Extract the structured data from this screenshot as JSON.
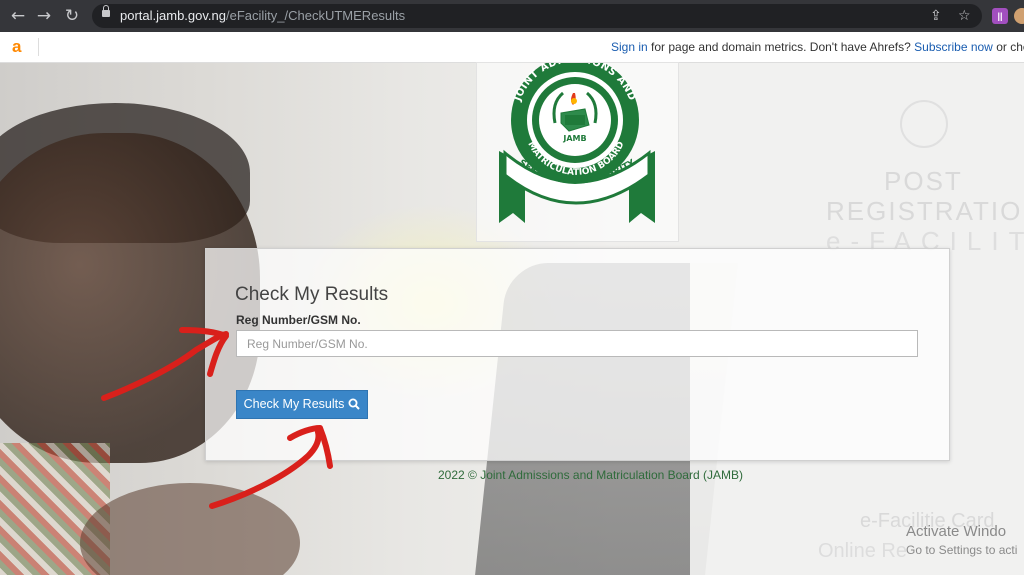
{
  "browser": {
    "url_host": "portal.jamb.gov.ng",
    "url_path": "/eFacility_/CheckUTMEResults"
  },
  "ahrefs": {
    "logo": "a",
    "sign_in": "Sign in",
    "text1": " for page and domain metrics. Don't have Ahrefs? ",
    "subscribe": "Subscribe now",
    "text2": " or check our"
  },
  "logo": {
    "ring_text_top": "JOINT ADMISSIONS AND",
    "ring_text_bottom": "MATRICULATION BOARD",
    "center": "JAMB",
    "motto": "SERVICE AND INTEGRITY"
  },
  "watermark": {
    "line1": "POST",
    "line2": "REGISTRATION",
    "line3": "e-FACILITY",
    "card1": "e-Facilitie Card",
    "card2": "Online Re"
  },
  "form": {
    "title": "Check My Results",
    "field_label": "Reg Number/GSM No.",
    "field_placeholder": "Reg Number/GSM No.",
    "field_value": "",
    "button_label": "Check My Results"
  },
  "footer": "2022 © Joint Admissions and Matriculation Board (JAMB)",
  "windows": {
    "activate_title": "Activate Windo",
    "activate_sub": "Go to Settings to acti"
  },
  "colors": {
    "jamb_green": "#1f7a3a",
    "button_blue": "#3a86c8",
    "annotation_red": "#d9201b",
    "ahrefs_orange": "#ff8800"
  },
  "icons": [
    "back-arrow-icon",
    "forward-arrow-icon",
    "reload-icon",
    "lock-icon",
    "share-icon",
    "star-icon",
    "extension-icon",
    "search-icon"
  ]
}
